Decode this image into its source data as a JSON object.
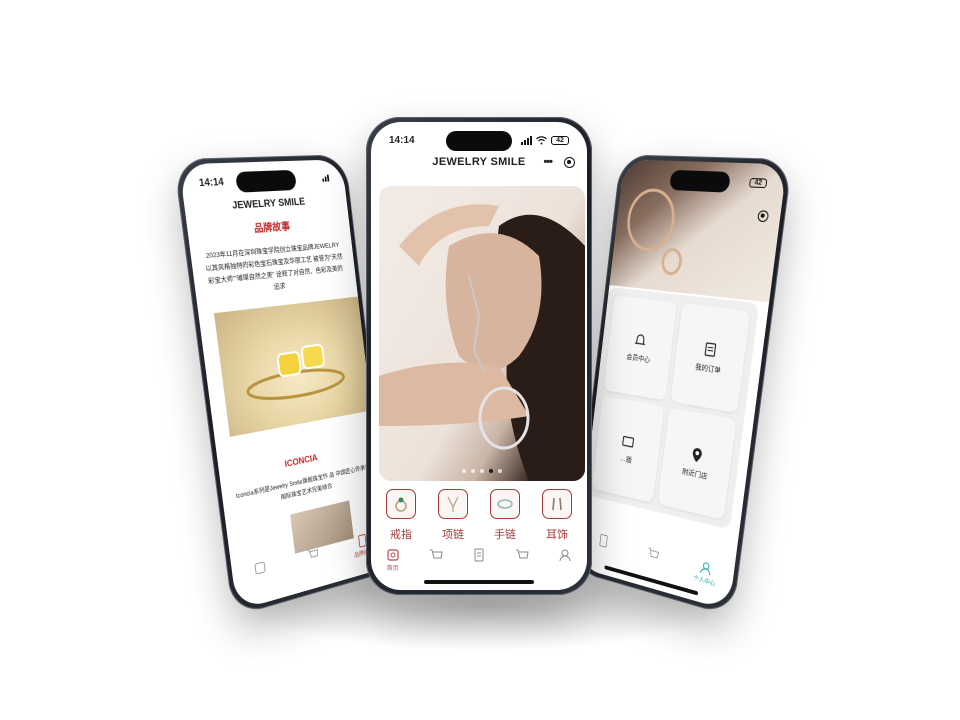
{
  "status": {
    "time": "14:14",
    "battery": "42"
  },
  "brand": "JEWELRY SMILE",
  "capsule": {
    "more_icon": "more-dots-icon",
    "close_icon": "target-icon"
  },
  "center": {
    "carousel": {
      "total": 5,
      "active_index": 3
    },
    "categories": [
      {
        "label": "戒指",
        "icon": "ring-icon"
      },
      {
        "label": "项链",
        "icon": "necklace-icon"
      },
      {
        "label": "手链",
        "icon": "bracelet-icon"
      },
      {
        "label": "耳饰",
        "icon": "earring-icon"
      }
    ],
    "tabs": [
      {
        "label": "首页",
        "icon": "home-icon"
      },
      {
        "label": "",
        "icon": "cart-icon"
      },
      {
        "label": "",
        "icon": "document-icon"
      },
      {
        "label": "",
        "icon": "cart-icon"
      },
      {
        "label": "",
        "icon": "user-icon"
      }
    ]
  },
  "left": {
    "section_title": "品牌故事",
    "paragraph": "2023年11月在深圳珠宝学院创立珠宝品牌JEWELRY 以其风格独特的彩色宝石珠宝及华丽工艺 被誉为“天然彩宝大师”“璀璨自然之美” 诠释了对自然、色彩及美的追求",
    "collection_title": "ICONCIA",
    "collection_text": "Iconcia系列是Jewelry Smile旗舰珠宝作 品 中国匠心传承与国际珠宝艺术完美结合",
    "tabs": [
      {
        "label": "",
        "icon": "home-icon"
      },
      {
        "label": "",
        "icon": "cart-icon"
      },
      {
        "label": "品牌故事",
        "icon": "document-icon"
      }
    ]
  },
  "right": {
    "menu": [
      {
        "label": "会员中心",
        "icon": "bell-icon"
      },
      {
        "label": "我的订单",
        "icon": "order-icon"
      },
      {
        "label": "…版",
        "icon": "card-icon"
      },
      {
        "label": "附近门店",
        "icon": "location-icon"
      }
    ],
    "tabs": [
      {
        "label": "",
        "icon": "document-icon"
      },
      {
        "label": "",
        "icon": "cart-icon"
      },
      {
        "label": "个人中心",
        "icon": "user-icon"
      }
    ]
  },
  "colors": {
    "accent": "#a33a3a",
    "title_red": "#c62828",
    "teal": "#21a5a0"
  }
}
